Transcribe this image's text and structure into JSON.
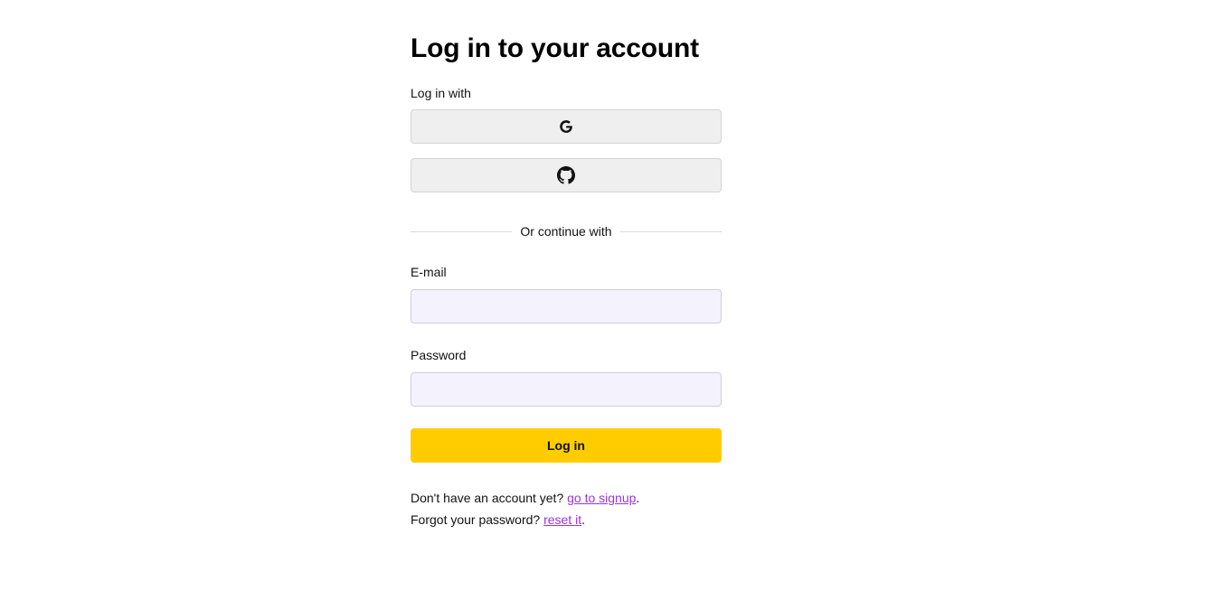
{
  "header": {
    "title": "Log in to your account"
  },
  "oauth": {
    "label": "Log in with",
    "providers": [
      {
        "name": "google-icon"
      },
      {
        "name": "github-icon"
      }
    ]
  },
  "divider": {
    "text": "Or continue with"
  },
  "form": {
    "email_label": "E-mail",
    "email_value": "",
    "password_label": "Password",
    "password_value": "",
    "submit_label": "Log in"
  },
  "footer": {
    "signup_prefix": "Don't have an account yet? ",
    "signup_link": "go to signup",
    "signup_suffix": ".",
    "reset_prefix": "Forgot your password? ",
    "reset_link": "reset it",
    "reset_suffix": "."
  },
  "colors": {
    "accent": "#ffcc00",
    "link": "#9b35d9",
    "input_bg": "#f4f2fd",
    "oauth_bg": "#efefef"
  }
}
